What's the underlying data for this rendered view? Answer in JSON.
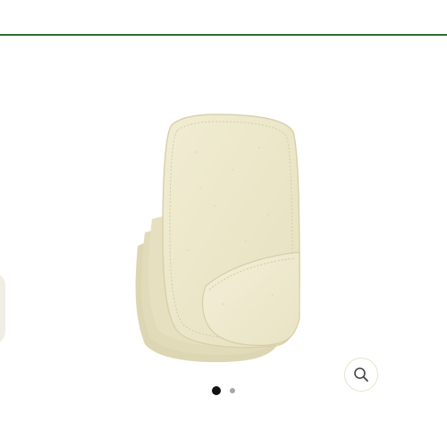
{
  "header": {
    "accent_color": "#2f6b34"
  },
  "gallery": {
    "image": {
      "subject": "stack-of-unbleached-cotton-cloth-wipes",
      "cloth_color": "#ece7c9"
    },
    "zoom_button": {
      "icon": "search-icon",
      "border_color": "#e8e3c8"
    },
    "pagination": {
      "total": 2,
      "active_index": 0,
      "active_color": "#111111",
      "inactive_color": "#a7a7a7"
    }
  }
}
